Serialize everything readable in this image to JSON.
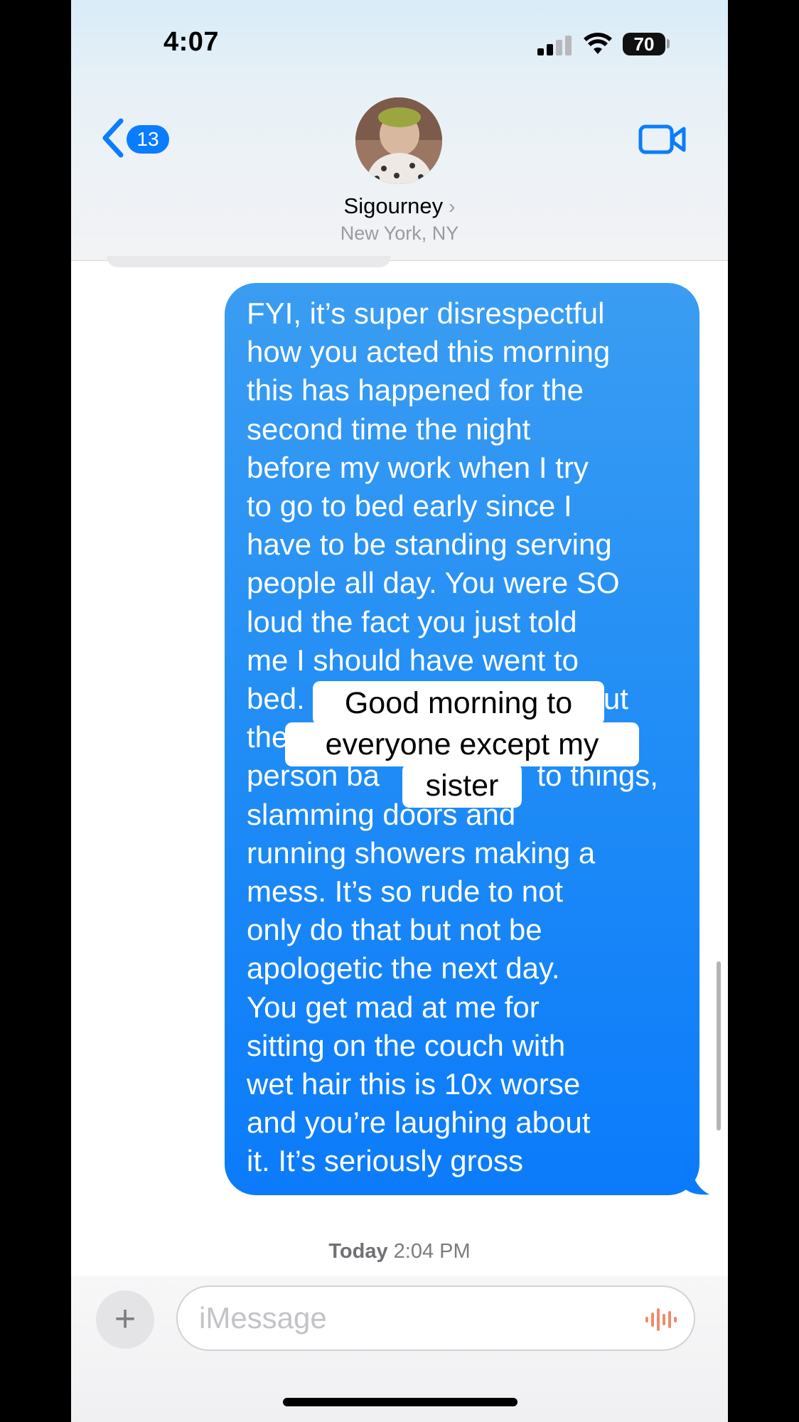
{
  "status_bar": {
    "time": "4:07",
    "battery": "70"
  },
  "header": {
    "back_count": "13",
    "contact_name": "Sigourney",
    "contact_location": "New York, NY"
  },
  "message": {
    "text": "FYI, it’s super disrespectful\nhow you acted this morning\nthis has happened for the\nsecond time the night\nbefore my work when I try\nto go to bed early since I\nhave to be standing serving\npeople all day. You were SO\nloud the fact you just told\nme I should have went to\nbed.                                  out\nthe\nperson ba                   to things,\nslamming doors and\nrunning showers making a\nmess. It’s so rude to not\nonly do that but not be\napologetic the next day.\nYou get mad at me for\nsitting on the couch with\nwet hair this is 10x worse\nand you’re laughing about\nit. It’s seriously gross"
  },
  "overlay": {
    "line1": "Good morning to",
    "line2": "everyone except my",
    "line3": "sister"
  },
  "timestamp": {
    "day": "Today",
    "time": "2:04 PM"
  },
  "composer": {
    "placeholder": "iMessage",
    "plus": "+"
  },
  "colors": {
    "accent": "#0a7cff",
    "bubble_top": "#3a9df2",
    "bubble_bottom": "#0b7bfb"
  }
}
